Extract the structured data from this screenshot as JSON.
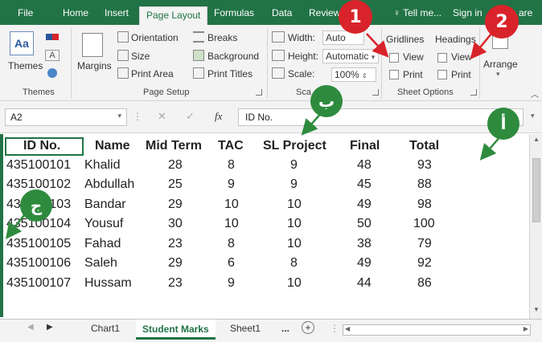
{
  "tabs": [
    {
      "label": "File"
    },
    {
      "label": "Home"
    },
    {
      "label": "Insert"
    },
    {
      "label": "Page Layout"
    },
    {
      "label": "Formulas"
    },
    {
      "label": "Data"
    },
    {
      "label": "Review"
    }
  ],
  "tell_me": "Tell me...",
  "sign_in": "Sign in",
  "share": "are",
  "ribbon": {
    "themes": {
      "btn": "Themes",
      "group": "Themes"
    },
    "page_setup": {
      "margins": "Margins",
      "orientation": "Orientation",
      "size": "Size",
      "print_area": "Print Area",
      "breaks": "Breaks",
      "background": "Background",
      "print_titles": "Print Titles",
      "group": "Page Setup"
    },
    "scale": {
      "width_label": "Width:",
      "width_value": "Auto",
      "height_label": "Height:",
      "height_value": "Automatic",
      "scale_label": "Scale:",
      "scale_value": "100%",
      "group": "Sca"
    },
    "sheet_options": {
      "gridlines": "Gridlines",
      "headings": "Headings",
      "view": "View",
      "print": "Print",
      "group": "Sheet Options"
    },
    "arrange": "Arrange"
  },
  "formula_bar": {
    "name_box": "A2",
    "fx": "fx",
    "content": "ID No."
  },
  "table": {
    "headers": [
      "ID No.",
      "Name",
      "Mid Term",
      "TAC",
      "SL Project",
      "Final",
      "Total"
    ],
    "rows": [
      [
        "435100101",
        "Khalid",
        "28",
        "8",
        "9",
        "48",
        "93"
      ],
      [
        "435100102",
        "Abdullah",
        "25",
        "9",
        "9",
        "45",
        "88"
      ],
      [
        "435100103",
        "Bandar",
        "29",
        "10",
        "10",
        "49",
        "98"
      ],
      [
        "435100104",
        "Yousuf",
        "30",
        "10",
        "10",
        "50",
        "100"
      ],
      [
        "435100105",
        "Fahad",
        "23",
        "8",
        "10",
        "38",
        "79"
      ],
      [
        "435100106",
        "Saleh",
        "29",
        "6",
        "8",
        "49",
        "92"
      ],
      [
        "435100107",
        "Hussam",
        "23",
        "9",
        "10",
        "44",
        "86"
      ]
    ]
  },
  "sheet_tabs": [
    "Chart1",
    "Student Marks",
    "Sheet1"
  ],
  "sheet_more": "...",
  "callouts": {
    "one": "1",
    "two": "2",
    "b": "ب",
    "a": "أ",
    "j": "ج"
  },
  "colors": {
    "excel_green": "#217346",
    "callout_red": "#d9232a",
    "callout_green": "#2e8b3e"
  }
}
